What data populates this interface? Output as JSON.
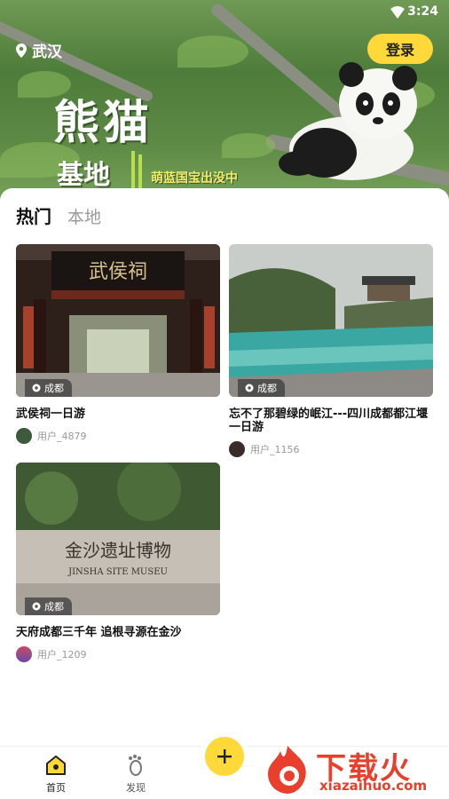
{
  "status_bar": {
    "time": "3:24"
  },
  "header": {
    "location": "武汉",
    "login_label": "登录"
  },
  "banner": {
    "title": "熊猫",
    "subtitle": "基地",
    "tagline": "萌蓝国宝出没中"
  },
  "tabs": [
    {
      "label": "热门",
      "active": true
    },
    {
      "label": "本地",
      "active": false
    }
  ],
  "cards": [
    {
      "title": "武侯祠一日游",
      "city": "成都",
      "author": "用户_4879"
    },
    {
      "title": "忘不了那碧绿的岷江---四川成都都江堰一日游",
      "city": "成都",
      "author": "用户_1156"
    },
    {
      "title": "天府成都三千年 追根寻源在金沙",
      "city": "成都",
      "author": "用户_1209"
    }
  ],
  "card_images": {
    "card1_sign": "武侯祠",
    "card3_sign_cn": "金沙遗址博物",
    "card3_sign_en": "JINSHA SITE MUSEU"
  },
  "bottom_nav": [
    {
      "label": "首页",
      "icon": "home-icon",
      "active": true
    },
    {
      "label": "发现",
      "icon": "footprint-icon",
      "active": false
    }
  ],
  "watermark": {
    "text": "下载火",
    "url": "xiazaihuo.com"
  },
  "colors": {
    "accent": "#ffd93a",
    "watermark": "#e8402c"
  }
}
